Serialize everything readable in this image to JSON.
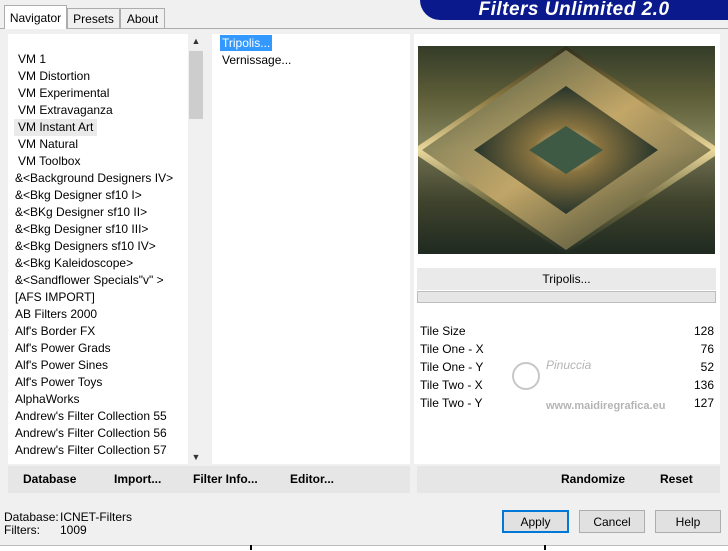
{
  "tabs": {
    "navigator": "Navigator",
    "presets": "Presets",
    "about": "About"
  },
  "banner": {
    "title": "Filters Unlimited 2.0"
  },
  "categories": [
    {
      "label": "VM 1"
    },
    {
      "label": "VM Distortion"
    },
    {
      "label": "VM Experimental"
    },
    {
      "label": "VM Extravaganza"
    },
    {
      "label": "VM Instant Art",
      "selected": true
    },
    {
      "label": "VM Natural"
    },
    {
      "label": "VM Toolbox"
    },
    {
      "label": "&<Background Designers IV>"
    },
    {
      "label": "&<Bkg Designer sf10 I>"
    },
    {
      "label": "&<BKg Designer sf10 II>"
    },
    {
      "label": "&<Bkg Designer sf10 III>"
    },
    {
      "label": "&<Bkg Designers sf10 IV>"
    },
    {
      "label": "&<Bkg Kaleidoscope>"
    },
    {
      "label": "&<Sandflower Specials\"v\" >"
    },
    {
      "label": "[AFS IMPORT]"
    },
    {
      "label": "AB Filters 2000"
    },
    {
      "label": "Alf's Border FX"
    },
    {
      "label": "Alf's Power Grads"
    },
    {
      "label": "Alf's Power Sines"
    },
    {
      "label": "Alf's Power Toys"
    },
    {
      "label": "AlphaWorks"
    },
    {
      "label": "Andrew's Filter Collection 55"
    },
    {
      "label": "Andrew's Filter Collection 56"
    },
    {
      "label": "Andrew's Filter Collection 57"
    }
  ],
  "filters": [
    {
      "label": "Tripolis...",
      "selected": true
    },
    {
      "label": "Vernissage..."
    }
  ],
  "preview": {
    "filter_name": "Tripolis..."
  },
  "params": [
    {
      "label": "Tile Size",
      "value": "128"
    },
    {
      "label": "Tile One - X",
      "value": "76"
    },
    {
      "label": "Tile One - Y",
      "value": "52"
    },
    {
      "label": "Tile Two - X",
      "value": "136"
    },
    {
      "label": "Tile Two - Y",
      "value": "127"
    }
  ],
  "watermark": {
    "brand": "Pinuccia",
    "url": "www.maidiregrafica.eu"
  },
  "buttons": {
    "database": "Database",
    "import": "Import...",
    "filter_info": "Filter Info...",
    "editor": "Editor...",
    "randomize": "Randomize",
    "reset": "Reset",
    "apply": "Apply",
    "cancel": "Cancel",
    "help": "Help"
  },
  "status": {
    "database_label": "Database:",
    "database_value": "ICNET-Filters",
    "filters_label": "Filters:",
    "filters_value": "1009"
  }
}
